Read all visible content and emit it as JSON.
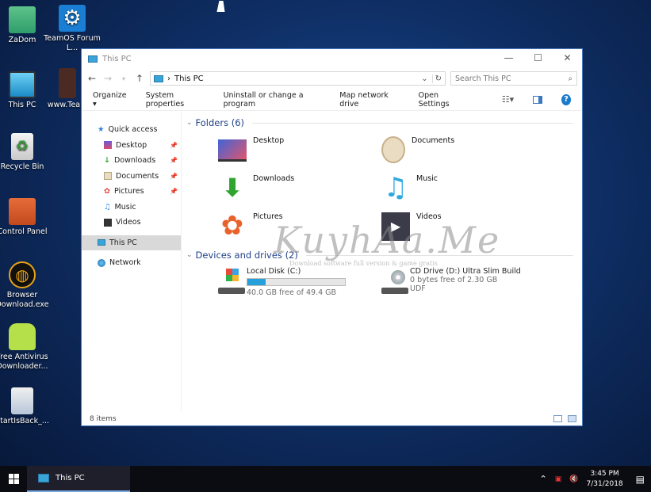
{
  "desktop": {
    "icons": [
      {
        "label": "ZaDom"
      },
      {
        "label": "TeamOS Forum L..."
      },
      {
        "label": "This PC"
      },
      {
        "label": "www.Tea..."
      },
      {
        "label": "Recycle Bin"
      },
      {
        "label": "Control Panel"
      },
      {
        "label": "Browser Download.exe"
      },
      {
        "label": "Free Antivirus Downloader..."
      },
      {
        "label": "StartIsBack_..."
      }
    ]
  },
  "window": {
    "title": "This PC",
    "controls": {
      "minimize": "—",
      "maximize": "☐",
      "close": "✕"
    },
    "address": {
      "separator": "›",
      "path": "This PC"
    },
    "search_placeholder": "Search This PC",
    "commands": {
      "organize": "Organize ▾",
      "system_properties": "System properties",
      "uninstall": "Uninstall or change a program",
      "map_drive": "Map network drive",
      "open_settings": "Open Settings",
      "help": "?"
    },
    "nav": {
      "quick_access": "Quick access",
      "desktop": "Desktop",
      "downloads": "Downloads",
      "documents": "Documents",
      "pictures": "Pictures",
      "music": "Music",
      "videos": "Videos",
      "this_pc": "This PC",
      "network": "Network"
    },
    "folders_header": "Folders (6)",
    "folders": [
      {
        "name": "Desktop"
      },
      {
        "name": "Documents"
      },
      {
        "name": "Downloads"
      },
      {
        "name": "Music"
      },
      {
        "name": "Pictures"
      },
      {
        "name": "Videos"
      }
    ],
    "drives_header": "Devices and drives (2)",
    "drives": [
      {
        "name": "Local Disk (C:)",
        "free": "40.0 GB free of 49.4 GB",
        "used_fraction": 0.19
      },
      {
        "name": "CD Drive (D:) Ultra Slim Build",
        "free": "0 bytes free of 2.30 GB",
        "fs": "UDF"
      }
    ],
    "status": "8 items"
  },
  "watermark": {
    "text": "KuyhAa.Me",
    "sub": "Download software full version & game gratis"
  },
  "taskbar": {
    "task_label": "This PC",
    "time": "3:45 PM",
    "date": "7/31/2018"
  },
  "colors": {
    "accent": "#26a0da",
    "header": "#1e3f86"
  }
}
